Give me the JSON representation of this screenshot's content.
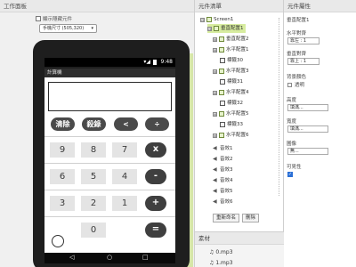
{
  "work_panel": {
    "header": "工作面板",
    "hidden_checkbox_label": "顯示隱藏元件",
    "size_select": "手機尺寸 (505,320)"
  },
  "phone": {
    "time": "9:48",
    "app_title": "計算機",
    "func_buttons": [
      "清除",
      "殺錄",
      "<",
      "÷"
    ],
    "rows": [
      {
        "nums": [
          "9",
          "8",
          "7"
        ],
        "op": "x"
      },
      {
        "nums": [
          "6",
          "5",
          "4"
        ],
        "op": "-"
      },
      {
        "nums": [
          "3",
          "2",
          "1"
        ],
        "op": "+"
      },
      {
        "nums": [
          "",
          "0",
          ""
        ],
        "op": "="
      }
    ],
    "nav": [
      "◁",
      "○",
      "□"
    ]
  },
  "components": {
    "header": "元件清單",
    "items": [
      {
        "label": "Screen1",
        "toggle": "⊟",
        "icon": "screen"
      },
      {
        "label": "垂直配置1",
        "toggle": "⊟",
        "icon": "arrangement",
        "selected": true
      },
      {
        "label": "垂直配置2",
        "toggle": "⊞",
        "icon": "arrangement"
      },
      {
        "label": "水平配置1",
        "toggle": "⊞",
        "icon": "arrangement"
      },
      {
        "label": "標籤30",
        "toggle": "",
        "icon": "label"
      },
      {
        "label": "水平配置3",
        "toggle": "⊞",
        "icon": "arrangement"
      },
      {
        "label": "標籤31",
        "toggle": "",
        "icon": "label"
      },
      {
        "label": "水平配置4",
        "toggle": "⊞",
        "icon": "arrangement"
      },
      {
        "label": "標籤32",
        "toggle": "",
        "icon": "label"
      },
      {
        "label": "水平配置5",
        "toggle": "⊞",
        "icon": "arrangement"
      },
      {
        "label": "標籤33",
        "toggle": "",
        "icon": "label"
      },
      {
        "label": "水平配置6",
        "toggle": "⊞",
        "icon": "arrangement"
      },
      {
        "label": "音效1",
        "toggle": "",
        "icon": "sound"
      },
      {
        "label": "音效2",
        "toggle": "",
        "icon": "sound"
      },
      {
        "label": "音效3",
        "toggle": "",
        "icon": "sound"
      },
      {
        "label": "音效4",
        "toggle": "",
        "icon": "sound"
      },
      {
        "label": "音效5",
        "toggle": "",
        "icon": "sound"
      },
      {
        "label": "音效6",
        "toggle": "",
        "icon": "sound"
      }
    ],
    "rename_button": "重新命名",
    "delete_button": "刪除"
  },
  "media": {
    "header": "素材",
    "files": [
      "0.mp3",
      "1.mp3"
    ]
  },
  "properties": {
    "header": "元件屬性",
    "component_name": "垂直配置1",
    "fields": [
      {
        "label": "水平對齊",
        "value": "靠左 : 1"
      },
      {
        "label": "垂直對齊",
        "value": "靠上 : 1"
      },
      {
        "label": "背景顏色",
        "value": "透明"
      },
      {
        "label": "高度",
        "value": "填滿..."
      },
      {
        "label": "寬度",
        "value": "填滿..."
      },
      {
        "label": "圖像",
        "value": "無..."
      },
      {
        "label": "可見性",
        "value": ""
      }
    ]
  }
}
